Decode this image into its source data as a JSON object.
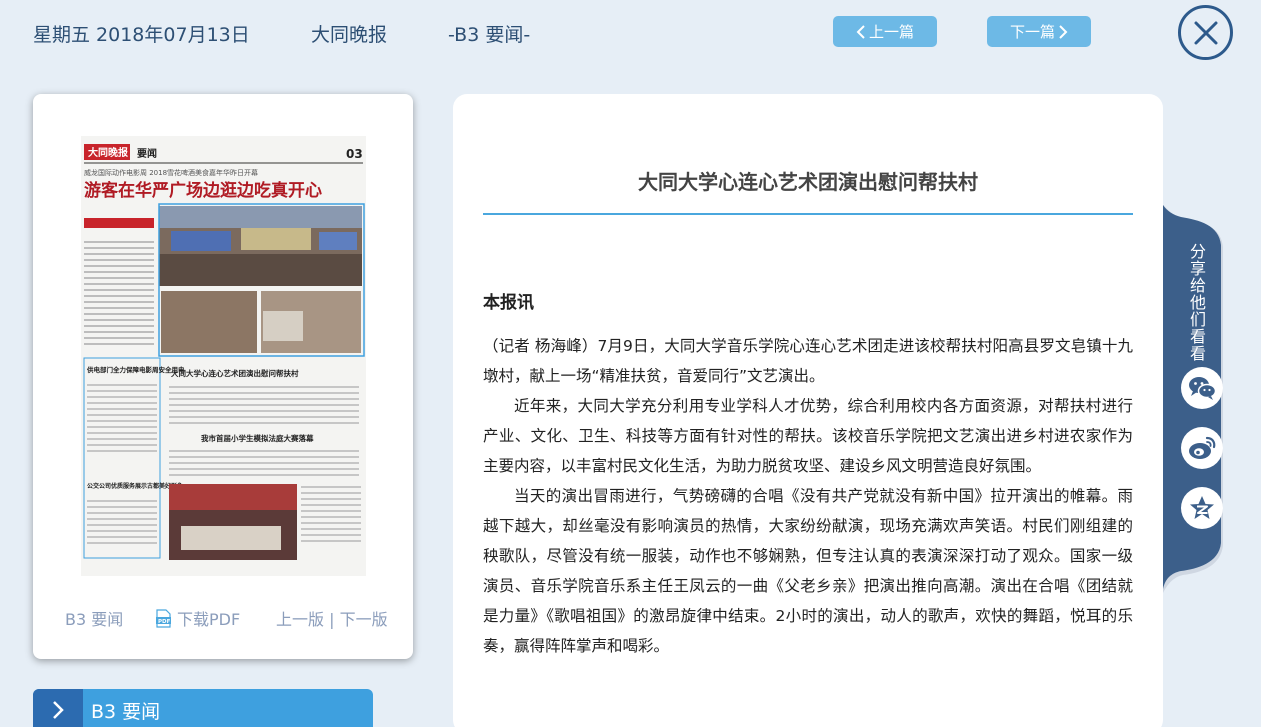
{
  "header": {
    "date": "星期五 2018年07月13日",
    "paper_name": "大同晚报",
    "section": "-B3 要闻-",
    "prev_label": "上一篇",
    "next_label": "下一篇"
  },
  "thumbnail": {
    "masthead": "大同晚报",
    "section": "要闻",
    "page_number": "03",
    "kicker": "威龙国际动作电影周 2018雪花啤酒美食嘉年华昨日开幕",
    "headline": "游客在华严广场边逛边吃真开心",
    "mid_headline": "大同大学心连心艺术团演出慰问帮扶村",
    "low_headline": "我市首届小学生模拟法庭大赛落幕",
    "side_1": "供电部门全力保障电影周安全用电",
    "side_2": "公交公司优质服务展示古都美好形象"
  },
  "card_footer": {
    "section": "B3 要闻",
    "download_pdf": "下载PDF",
    "prev_page": "上一版",
    "separator": "|",
    "next_page": "下一版"
  },
  "section_bar": {
    "label": "B3  要闻"
  },
  "article": {
    "title": "大同大学心连心艺术团演出慰问帮扶村",
    "lead": "本报讯",
    "paragraphs": [
      "（记者 杨海峰）7月9日，大同大学音乐学院心连心艺术团走进该校帮扶村阳高县罗文皂镇十九墩村，献上一场“精准扶贫，音爱同行”文艺演出。",
      "近年来，大同大学充分利用专业学科人才优势，综合利用校内各方面资源，对帮扶村进行产业、文化、卫生、科技等方面有针对性的帮扶。该校音乐学院把文艺演出进乡村进农家作为主要内容，以丰富村民文化生活，为助力脱贫攻坚、建设乡风文明营造良好氛围。",
      "当天的演出冒雨进行，气势磅礴的合唱《没有共产党就没有新中国》拉开演出的帷幕。雨越下越大，却丝毫没有影响演员的热情，大家纷纷献演，现场充满欢声笑语。村民们刚组建的秧歌队，尽管没有统一服装，动作也不够娴熟，但专注认真的表演深深打动了观众。国家一级演员、音乐学院音乐系主任王凤云的一曲《父老乡亲》把演出推向高潮。演出在合唱《团结就是力量》《歌唱祖国》的激昂旋律中结束。2小时的演出，动人的歌声，欢快的舞蹈，悦耳的乐奏，赢得阵阵掌声和喝彩。"
    ]
  },
  "share": {
    "title": "分享给他们看看",
    "icons": [
      "wechat-icon",
      "weibo-icon",
      "qzone-icon"
    ]
  },
  "colors": {
    "background": "#e6eef6",
    "header_text": "#2d4f74",
    "nav_button": "#6db9e6",
    "accent_blue": "#3ea0df",
    "share_tab": "#3c5f8a"
  }
}
